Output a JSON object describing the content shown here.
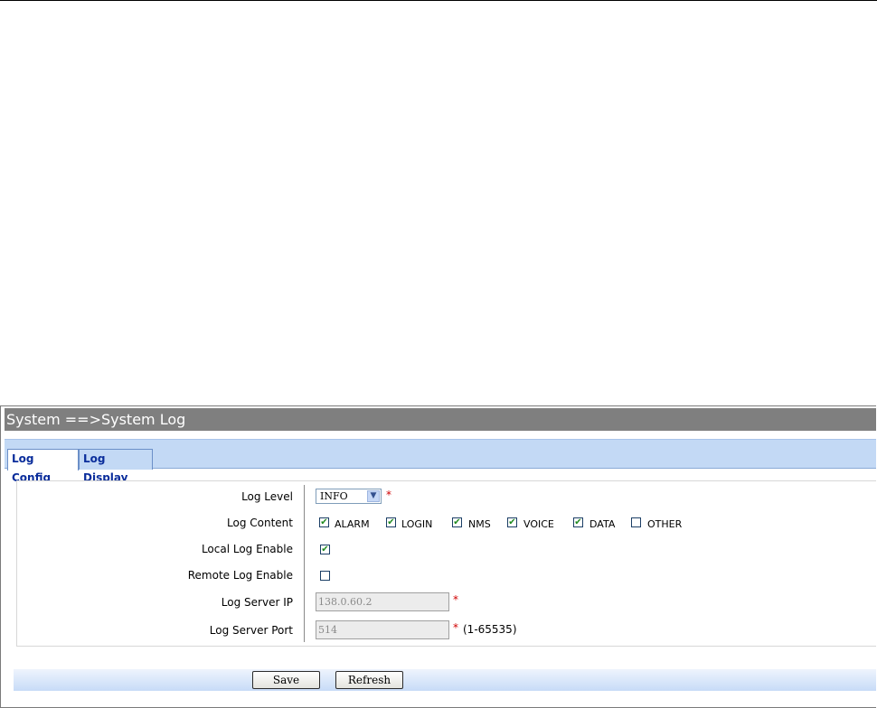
{
  "breadcrumb": "System ==>System Log",
  "tabs": [
    {
      "label": "Log Config",
      "active": true
    },
    {
      "label": "Log Display",
      "active": false
    }
  ],
  "form": {
    "log_level": {
      "label": "Log Level",
      "value": "INFO",
      "required_mark": "*"
    },
    "log_content": {
      "label": "Log Content",
      "options": [
        {
          "label": "ALARM",
          "checked": true
        },
        {
          "label": "LOGIN",
          "checked": true
        },
        {
          "label": "NMS",
          "checked": true
        },
        {
          "label": "VOICE",
          "checked": true
        },
        {
          "label": "DATA",
          "checked": true
        },
        {
          "label": "OTHER",
          "checked": false
        }
      ]
    },
    "local_log_enable": {
      "label": "Local Log Enable",
      "checked": true
    },
    "remote_log_enable": {
      "label": "Remote Log Enable",
      "checked": false
    },
    "log_server_ip": {
      "label": "Log Server IP",
      "value": "138.0.60.2",
      "required_mark": "*"
    },
    "log_server_port": {
      "label": "Log Server Port",
      "value": "514",
      "required_mark": "*",
      "range_note": "(1-65535)"
    }
  },
  "buttons": {
    "save": "Save",
    "refresh": "Refresh"
  },
  "colors": {
    "title_bar": "#7f7f7f",
    "tab_text": "#0a2d9b",
    "tab_strip": "#c3d9f5",
    "required": "#d00000",
    "check": "#1f8a1f"
  }
}
